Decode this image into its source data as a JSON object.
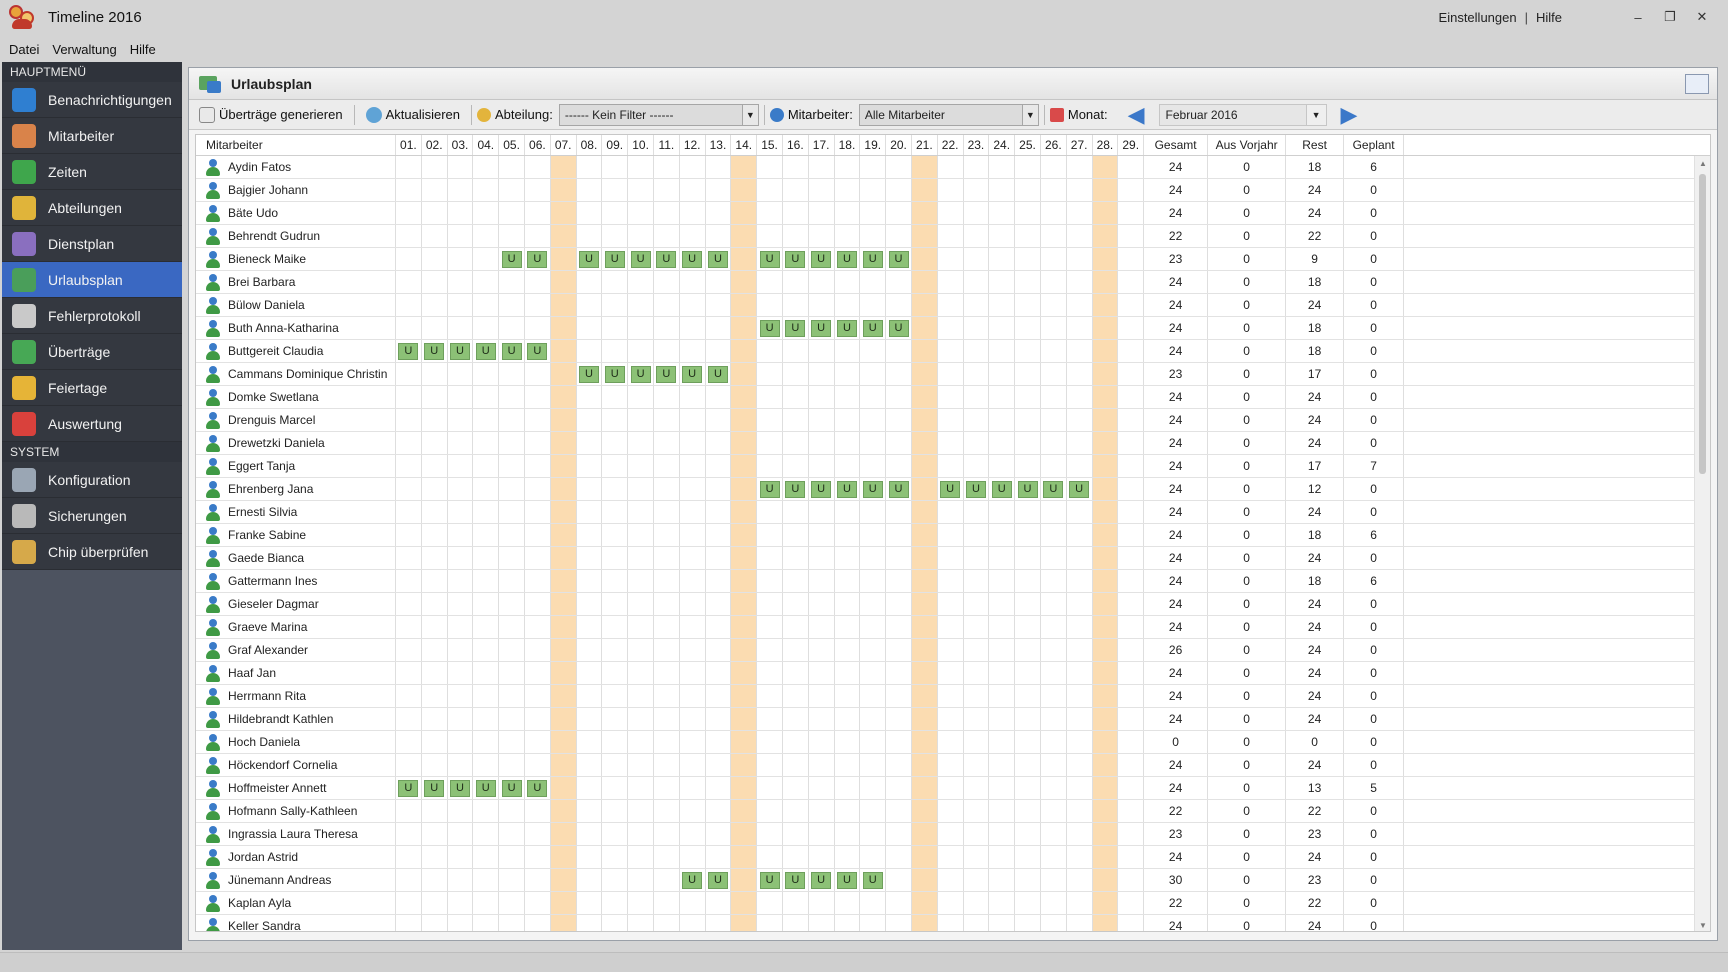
{
  "app": {
    "title": "Timeline 2016"
  },
  "titlebar": {
    "settings": "Einstellungen",
    "separator": "|",
    "help": "Hilfe",
    "min": "–",
    "restore": "❐",
    "close": "✕"
  },
  "menubar": {
    "items": [
      "Datei",
      "Verwaltung",
      "Hilfe"
    ]
  },
  "sidebar": {
    "section_main": "HAUPTMENÜ",
    "main_items": [
      {
        "label": "Benachrichtigungen",
        "icon": "notification-icon",
        "color": "#2f7fd1"
      },
      {
        "label": "Mitarbeiter",
        "icon": "employees-icon",
        "color": "#d9834a"
      },
      {
        "label": "Zeiten",
        "icon": "times-icon",
        "color": "#3fa64c"
      },
      {
        "label": "Abteilungen",
        "icon": "departments-icon",
        "color": "#e0b43a"
      },
      {
        "label": "Dienstplan",
        "icon": "roster-icon",
        "color": "#8a6fbf"
      },
      {
        "label": "Urlaubsplan",
        "icon": "vacation-icon",
        "color": "#4a9e5a"
      },
      {
        "label": "Fehlerprotokoll",
        "icon": "error-log-icon",
        "color": "#c9c9c9"
      },
      {
        "label": "Überträge",
        "icon": "transfers-icon",
        "color": "#47a855"
      },
      {
        "label": "Feiertage",
        "icon": "holidays-icon",
        "color": "#e6b437"
      },
      {
        "label": "Auswertung",
        "icon": "analysis-icon",
        "color": "#d9413c"
      }
    ],
    "section_system": "SYSTEM",
    "system_items": [
      {
        "label": "Konfiguration",
        "icon": "configuration-icon",
        "color": "#9aa6b4"
      },
      {
        "label": "Sicherungen",
        "icon": "backup-icon",
        "color": "#b9b9b9"
      },
      {
        "label": "Chip überprüfen",
        "icon": "chip-icon",
        "color": "#d6a94a"
      }
    ],
    "active": "Urlaubsplan"
  },
  "panel": {
    "title": "Urlaubsplan",
    "toolbar": {
      "generate": "Überträge generieren",
      "refresh": "Aktualisieren",
      "department_label": "Abteilung:",
      "department_value": "------ Kein Filter ------",
      "employee_label": "Mitarbeiter:",
      "employee_value": "Alle Mitarbeiter",
      "month_label": "Monat:",
      "month_value": "Februar 2016"
    }
  },
  "grid": {
    "columns": {
      "name": "Mitarbeiter",
      "days": [
        "01.",
        "02.",
        "03.",
        "04.",
        "05.",
        "06.",
        "07.",
        "08.",
        "09.",
        "10.",
        "11.",
        "12.",
        "13.",
        "14.",
        "15.",
        "16.",
        "17.",
        "18.",
        "19.",
        "20.",
        "21.",
        "22.",
        "23.",
        "24.",
        "25.",
        "26.",
        "27.",
        "28.",
        "29."
      ],
      "total": "Gesamt",
      "prev": "Aus Vorjahr",
      "rest": "Rest",
      "planned": "Geplant"
    },
    "weekend_days": [
      7,
      14,
      21,
      28
    ],
    "vacation_mark": "U",
    "weekend_color": "#fbdcb1",
    "vacation_color": "#8cc176",
    "rows": [
      {
        "name": "Aydin Fatos",
        "u": [],
        "total": "24",
        "prev": "0",
        "rest": "18",
        "planned": "6"
      },
      {
        "name": "Bajgier Johann",
        "u": [],
        "total": "24",
        "prev": "0",
        "rest": "24",
        "planned": "0"
      },
      {
        "name": "Bäte Udo",
        "u": [],
        "total": "24",
        "prev": "0",
        "rest": "24",
        "planned": "0"
      },
      {
        "name": "Behrendt Gudrun",
        "u": [],
        "total": "22",
        "prev": "0",
        "rest": "22",
        "planned": "0"
      },
      {
        "name": "Bieneck Maike",
        "u": [
          5,
          6,
          8,
          9,
          10,
          11,
          12,
          13,
          15,
          16,
          17,
          18,
          19,
          20
        ],
        "total": "23",
        "prev": "0",
        "rest": "9",
        "planned": "0"
      },
      {
        "name": "Brei Barbara",
        "u": [],
        "total": "24",
        "prev": "0",
        "rest": "18",
        "planned": "0"
      },
      {
        "name": "Bülow Daniela",
        "u": [],
        "total": "24",
        "prev": "0",
        "rest": "24",
        "planned": "0"
      },
      {
        "name": "Buth Anna-Katharina",
        "u": [
          15,
          16,
          17,
          18,
          19,
          20
        ],
        "total": "24",
        "prev": "0",
        "rest": "18",
        "planned": "0"
      },
      {
        "name": "Buttgereit Claudia",
        "u": [
          1,
          2,
          3,
          4,
          5,
          6
        ],
        "total": "24",
        "prev": "0",
        "rest": "18",
        "planned": "0"
      },
      {
        "name": "Cammans Dominique Christin",
        "u": [
          8,
          9,
          10,
          11,
          12,
          13
        ],
        "total": "23",
        "prev": "0",
        "rest": "17",
        "planned": "0"
      },
      {
        "name": "Domke Swetlana",
        "u": [],
        "total": "24",
        "prev": "0",
        "rest": "24",
        "planned": "0"
      },
      {
        "name": "Drenguis Marcel",
        "u": [],
        "total": "24",
        "prev": "0",
        "rest": "24",
        "planned": "0"
      },
      {
        "name": "Drewetzki Daniela",
        "u": [],
        "total": "24",
        "prev": "0",
        "rest": "24",
        "planned": "0"
      },
      {
        "name": "Eggert Tanja",
        "u": [],
        "total": "24",
        "prev": "0",
        "rest": "17",
        "planned": "7"
      },
      {
        "name": "Ehrenberg Jana",
        "u": [
          15,
          16,
          17,
          18,
          19,
          20,
          22,
          23,
          24,
          25,
          26,
          27
        ],
        "total": "24",
        "prev": "0",
        "rest": "12",
        "planned": "0"
      },
      {
        "name": "Ernesti Silvia",
        "u": [],
        "total": "24",
        "prev": "0",
        "rest": "24",
        "planned": "0"
      },
      {
        "name": "Franke Sabine",
        "u": [],
        "total": "24",
        "prev": "0",
        "rest": "18",
        "planned": "6"
      },
      {
        "name": "Gaede Bianca",
        "u": [],
        "total": "24",
        "prev": "0",
        "rest": "24",
        "planned": "0"
      },
      {
        "name": "Gattermann Ines",
        "u": [],
        "total": "24",
        "prev": "0",
        "rest": "18",
        "planned": "6"
      },
      {
        "name": "Gieseler Dagmar",
        "u": [],
        "total": "24",
        "prev": "0",
        "rest": "24",
        "planned": "0"
      },
      {
        "name": "Graeve Marina",
        "u": [],
        "total": "24",
        "prev": "0",
        "rest": "24",
        "planned": "0"
      },
      {
        "name": "Graf Alexander",
        "u": [],
        "total": "26",
        "prev": "0",
        "rest": "24",
        "planned": "0"
      },
      {
        "name": "Haaf Jan",
        "u": [],
        "total": "24",
        "prev": "0",
        "rest": "24",
        "planned": "0"
      },
      {
        "name": "Herrmann Rita",
        "u": [],
        "total": "24",
        "prev": "0",
        "rest": "24",
        "planned": "0"
      },
      {
        "name": "Hildebrandt Kathlen",
        "u": [],
        "total": "24",
        "prev": "0",
        "rest": "24",
        "planned": "0"
      },
      {
        "name": "Hoch Daniela",
        "u": [],
        "total": "0",
        "prev": "0",
        "rest": "0",
        "planned": "0"
      },
      {
        "name": "Höckendorf Cornelia",
        "u": [],
        "total": "24",
        "prev": "0",
        "rest": "24",
        "planned": "0"
      },
      {
        "name": "Hoffmeister Annett",
        "u": [
          1,
          2,
          3,
          4,
          5,
          6
        ],
        "total": "24",
        "prev": "0",
        "rest": "13",
        "planned": "5"
      },
      {
        "name": "Hofmann Sally-Kathleen",
        "u": [],
        "total": "22",
        "prev": "0",
        "rest": "22",
        "planned": "0"
      },
      {
        "name": "Ingrassia Laura Theresa",
        "u": [],
        "total": "23",
        "prev": "0",
        "rest": "23",
        "planned": "0"
      },
      {
        "name": "Jordan Astrid",
        "u": [],
        "total": "24",
        "prev": "0",
        "rest": "24",
        "planned": "0"
      },
      {
        "name": "Jünemann Andreas",
        "u": [
          12,
          13,
          15,
          16,
          17,
          18,
          19
        ],
        "total": "30",
        "prev": "0",
        "rest": "23",
        "planned": "0"
      },
      {
        "name": "Kaplan Ayla",
        "u": [],
        "total": "22",
        "prev": "0",
        "rest": "22",
        "planned": "0"
      },
      {
        "name": "Keller Sandra",
        "u": [],
        "total": "24",
        "prev": "0",
        "rest": "24",
        "planned": "0"
      }
    ]
  }
}
